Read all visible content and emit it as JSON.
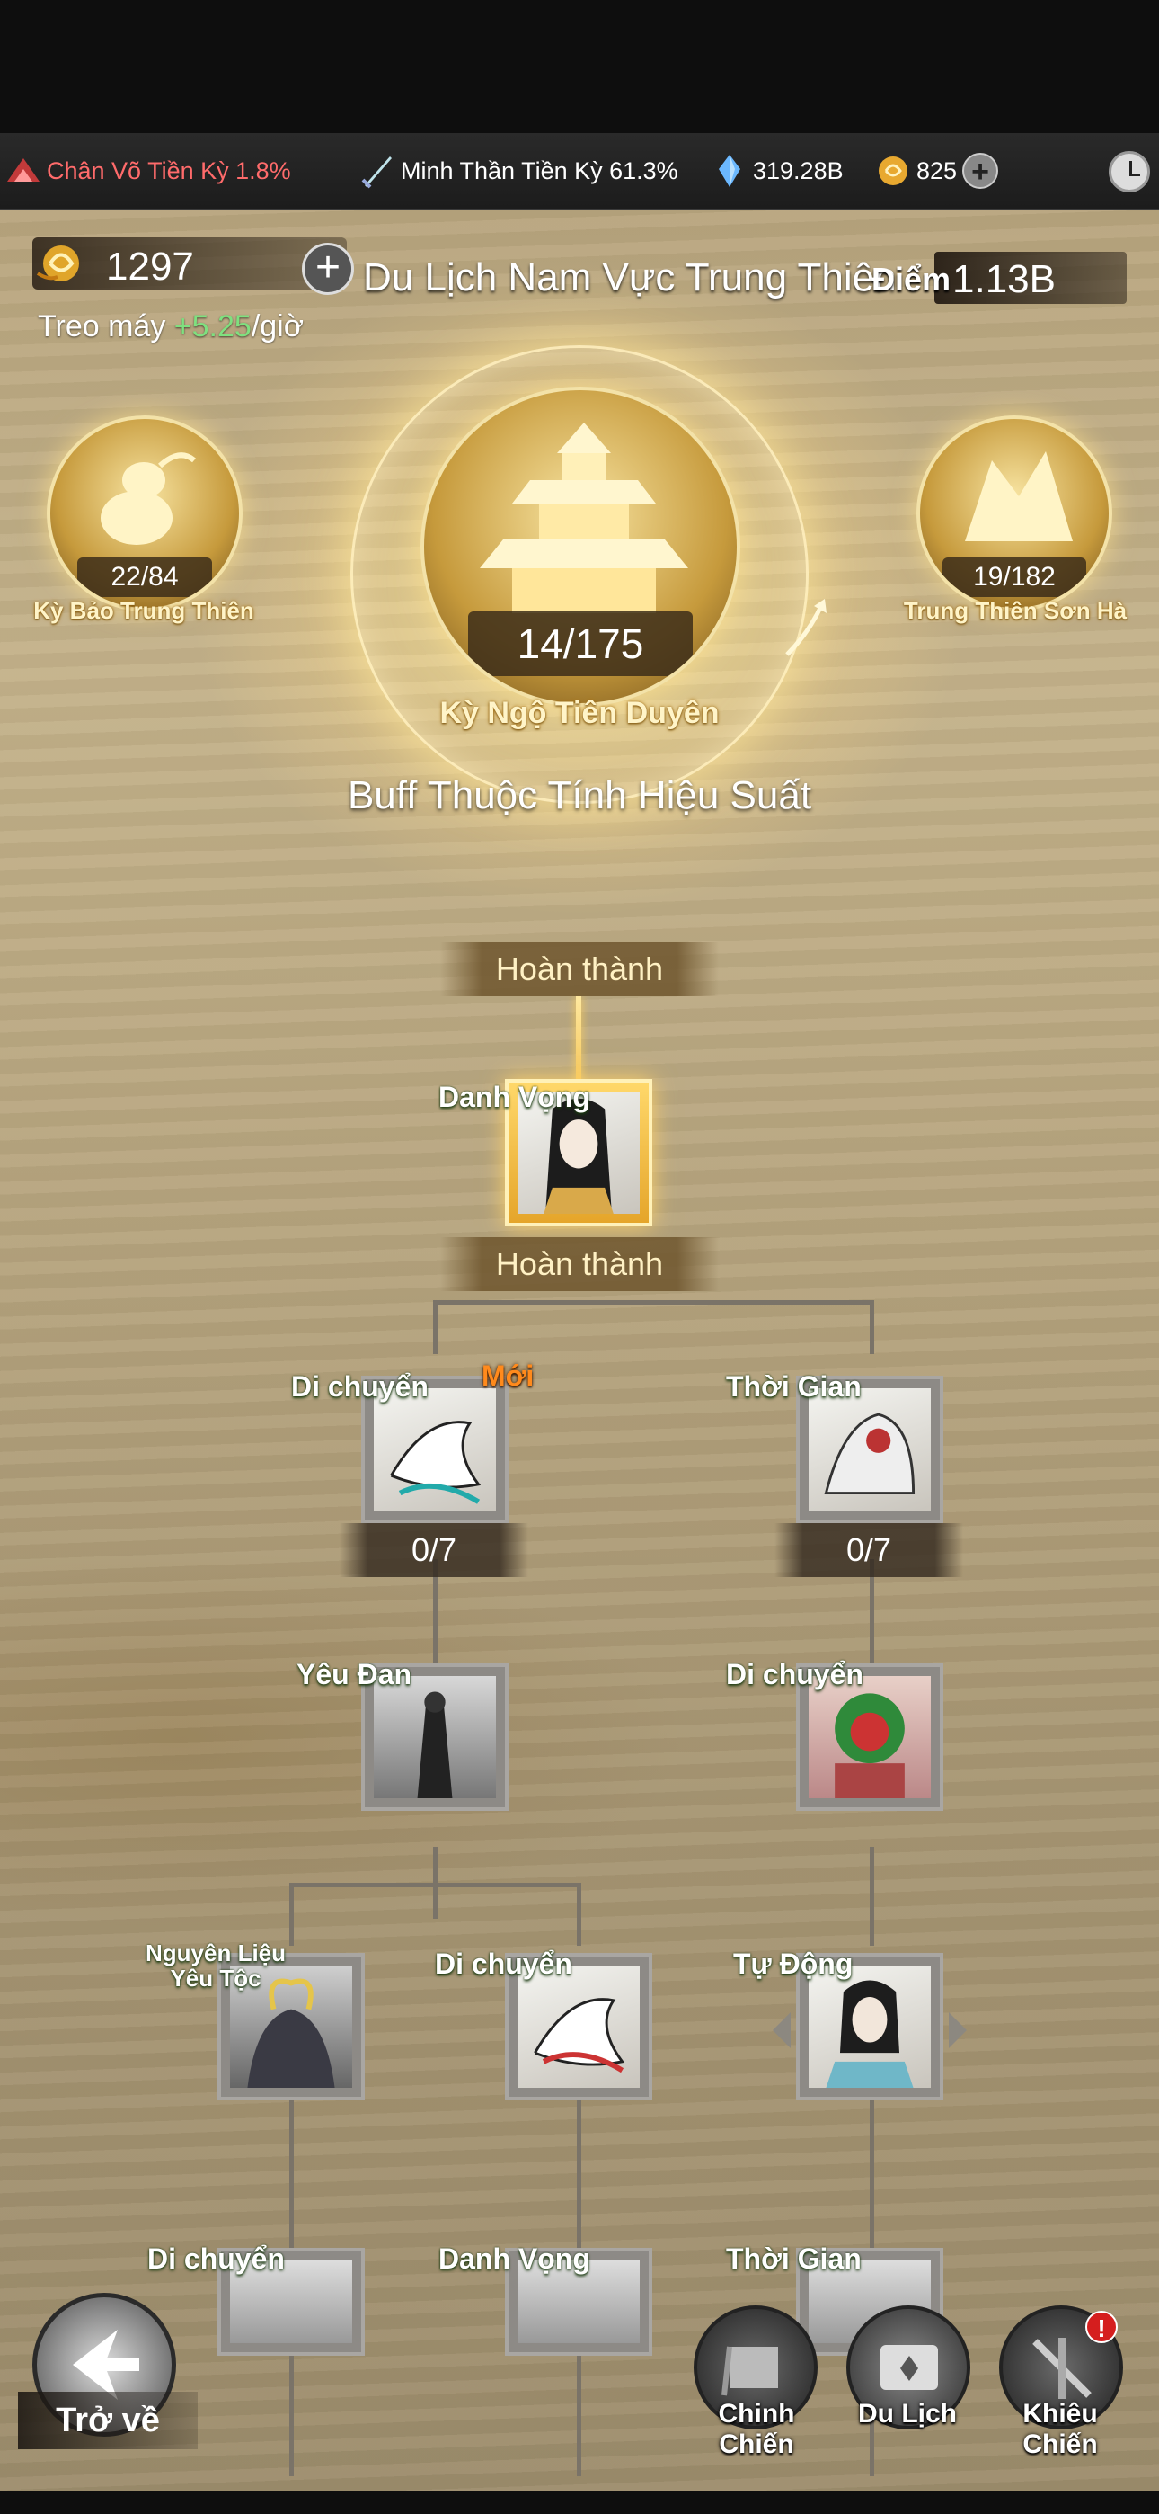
{
  "resource_bar": {
    "item1_label": "Chân Võ Tiền Kỳ 1.8%",
    "item2_label": "Minh Thần Tiền Kỳ 61.3%",
    "item3_value": "319.28B",
    "item4_value": "825"
  },
  "header": {
    "currency_value": "1297",
    "idle_prefix": "Treo máy",
    "idle_rate": "+5.25",
    "idle_suffix": "/giờ",
    "region_title": "Du Lịch Nam Vực Trung Thiên",
    "score_label": "Điểm",
    "score_value": "1.13B"
  },
  "orbs": {
    "left": {
      "count": "22/84",
      "caption": "Kỳ Bảo Trung Thiên"
    },
    "center": {
      "count": "14/175",
      "caption": "Kỳ Ngộ Tiên Duyên"
    },
    "right": {
      "count": "19/182",
      "caption": "Trung Thiên Sơn Hà"
    }
  },
  "buff_title": "Buff Thuộc Tính Hiệu Suất",
  "tree": {
    "top_status": "Hoàn thành",
    "root": {
      "tag": "Danh Vọng",
      "status": "Hoàn thành"
    },
    "row1": [
      {
        "tag": "Di chuyển",
        "new_label": "Mới",
        "progress": "0/7"
      },
      {
        "tag": "Thời Gian",
        "progress": "0/7"
      }
    ],
    "row2": [
      {
        "tag": "Yêu Đan"
      },
      {
        "tag": "Di chuyển"
      }
    ],
    "row3": [
      {
        "tag_line1": "Nguyên Liệu",
        "tag_line2": "Yêu Tộc"
      },
      {
        "tag": "Di chuyển"
      },
      {
        "tag": "Tự Động"
      }
    ],
    "row4": [
      {
        "tag": "Di chuyển"
      },
      {
        "tag": "Danh Vọng"
      },
      {
        "tag": "Thời Gian"
      }
    ]
  },
  "bottom_nav": {
    "back_label": "Trở về",
    "tabs": [
      "Chinh Chiến",
      "Du Lịch",
      "Khiêu Chiến"
    ],
    "alert": "!"
  }
}
